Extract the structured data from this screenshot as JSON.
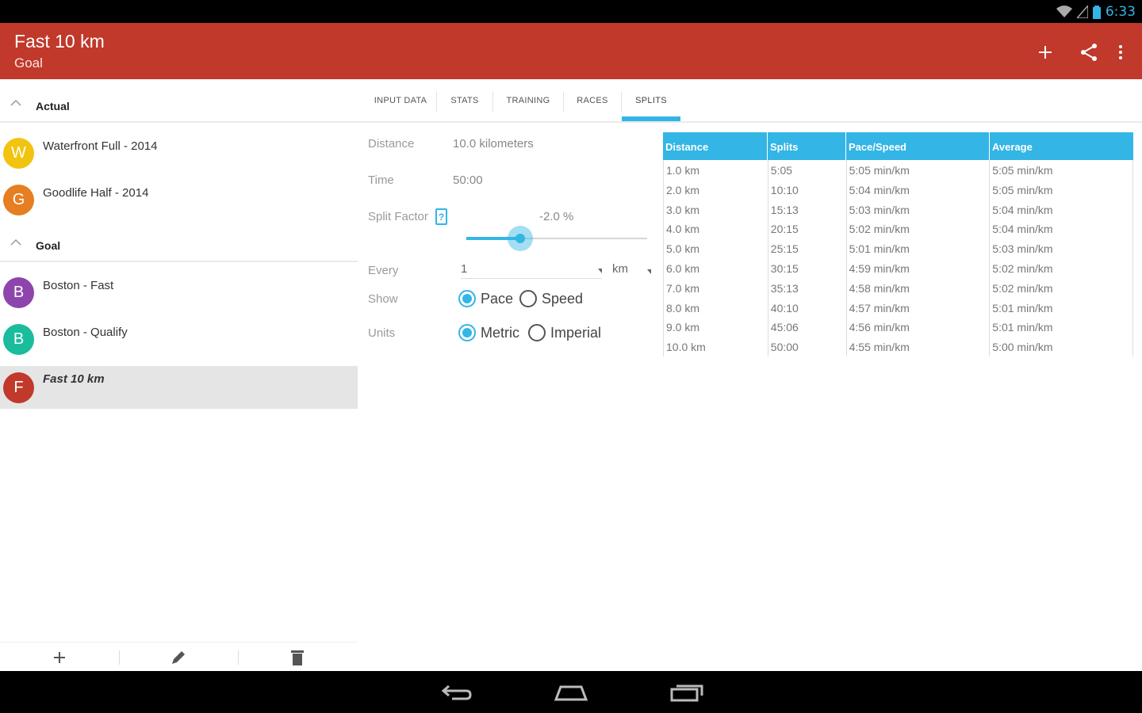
{
  "status_bar": {
    "time": "6:33"
  },
  "app_bar": {
    "title": "Fast 10 km",
    "subtitle": "Goal",
    "actions": [
      "add-icon",
      "share-icon",
      "overflow-menu-icon"
    ]
  },
  "left_panel": {
    "sections": [
      {
        "label": "Actual",
        "items": [
          {
            "initial": "W",
            "label": "Waterfront Full - 2014",
            "color": "#f2c40f"
          },
          {
            "initial": "G",
            "label": "Goodlife Half - 2014",
            "color": "#e67e22"
          }
        ]
      },
      {
        "label": "Goal",
        "items": [
          {
            "initial": "B",
            "label": "Boston - Fast",
            "color": "#8e44ad"
          },
          {
            "initial": "B",
            "label": "Boston - Qualify",
            "color": "#1abc9c"
          },
          {
            "initial": "F",
            "label": "Fast 10 km",
            "color": "#c0392b",
            "selected": true
          }
        ]
      }
    ],
    "toolbar": [
      "add-icon",
      "edit-icon",
      "delete-icon"
    ]
  },
  "tabs": [
    "INPUT DATA",
    "STATS",
    "TRAINING",
    "RACES",
    "SPLITS"
  ],
  "active_tab": "SPLITS",
  "form": {
    "distance_label": "Distance",
    "distance_value": "10.0 kilometers",
    "time_label": "Time",
    "time_value": "50:00",
    "split_factor_label": "Split Factor",
    "split_factor_help": "?",
    "split_factor_value": "-2.0 %",
    "split_factor_slider_fraction": 0.3,
    "every_label": "Every",
    "every_value": "1",
    "every_unit": "km",
    "show_label": "Show",
    "show_options": [
      "Pace",
      "Speed"
    ],
    "show_selected": "Pace",
    "units_label": "Units",
    "units_options": [
      "Metric",
      "Imperial"
    ],
    "units_selected": "Metric"
  },
  "splits_table": {
    "headers": [
      "Distance",
      "Splits",
      "Pace/Speed",
      "Average"
    ],
    "rows": [
      [
        "1.0 km",
        "5:05",
        "5:05 min/km",
        "5:05 min/km"
      ],
      [
        "2.0 km",
        "10:10",
        "5:04 min/km",
        "5:05 min/km"
      ],
      [
        "3.0 km",
        "15:13",
        "5:03 min/km",
        "5:04 min/km"
      ],
      [
        "4.0 km",
        "20:15",
        "5:02 min/km",
        "5:04 min/km"
      ],
      [
        "5.0 km",
        "25:15",
        "5:01 min/km",
        "5:03 min/km"
      ],
      [
        "6.0 km",
        "30:15",
        "4:59 min/km",
        "5:02 min/km"
      ],
      [
        "7.0 km",
        "35:13",
        "4:58 min/km",
        "5:02 min/km"
      ],
      [
        "8.0 km",
        "40:10",
        "4:57 min/km",
        "5:01 min/km"
      ],
      [
        "9.0 km",
        "45:06",
        "4:56 min/km",
        "5:01 min/km"
      ],
      [
        "10.0 km",
        "50:00",
        "4:55 min/km",
        "5:00 min/km"
      ]
    ]
  },
  "nav_bar": [
    "back-icon",
    "home-icon",
    "recents-icon"
  ],
  "colors": {
    "accent": "#33b5e5",
    "app_bar": "#c0392b"
  }
}
